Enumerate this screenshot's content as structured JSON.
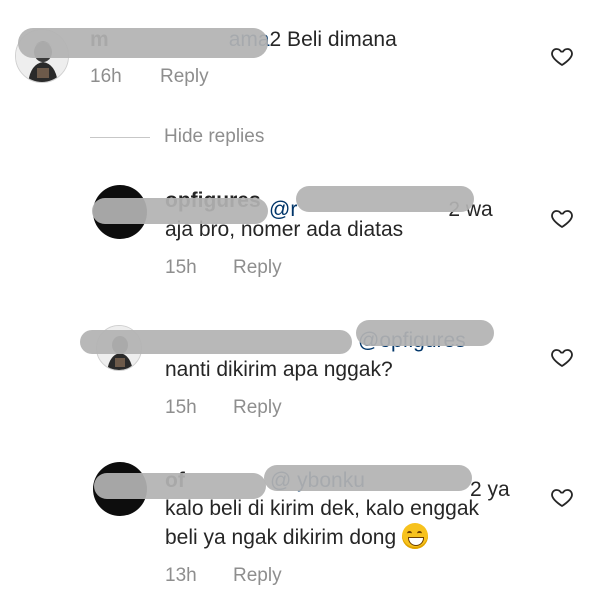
{
  "comments": [
    {
      "id": "c1",
      "author_visible": "m",
      "mention_visible": "ama",
      "text": "2 Beli dimana",
      "time": "16h",
      "reply_label": "Reply",
      "avatar": "photo-avatar",
      "liked": false
    }
  ],
  "hide_replies_label": "Hide replies",
  "replies": [
    {
      "id": "r1",
      "author_visible": "opfigures",
      "mention_visible": "@r",
      "text_line1_tail": "2 wa",
      "text_line2": "aja bro, nomer ada diatas",
      "time": "15h",
      "reply_label": "Reply",
      "avatar": "dark-avatar"
    },
    {
      "id": "r2",
      "mention_visible": "@opfigures",
      "text_line2": "nanti dikirim apa nggak?",
      "time": "15h",
      "reply_label": "Reply",
      "avatar": "photo-avatar"
    },
    {
      "id": "r3",
      "author_visible": "of",
      "mention_visible": "@ ybonku",
      "text_line1_tail": "2 ya",
      "text_line2": "kalo beli di kirim dek, kalo enggak",
      "text_line3": "beli ya ngak dikirim dong",
      "time": "13h",
      "reply_label": "Reply",
      "avatar": "dark-avatar",
      "emoji": "grinning-sweat-emoji"
    }
  ],
  "icons": {
    "like": "heart-outline-icon"
  },
  "colors": {
    "text": "#262626",
    "meta": "#8e8e8e",
    "redaction": "#b3b3b3",
    "mention": "#003569"
  }
}
